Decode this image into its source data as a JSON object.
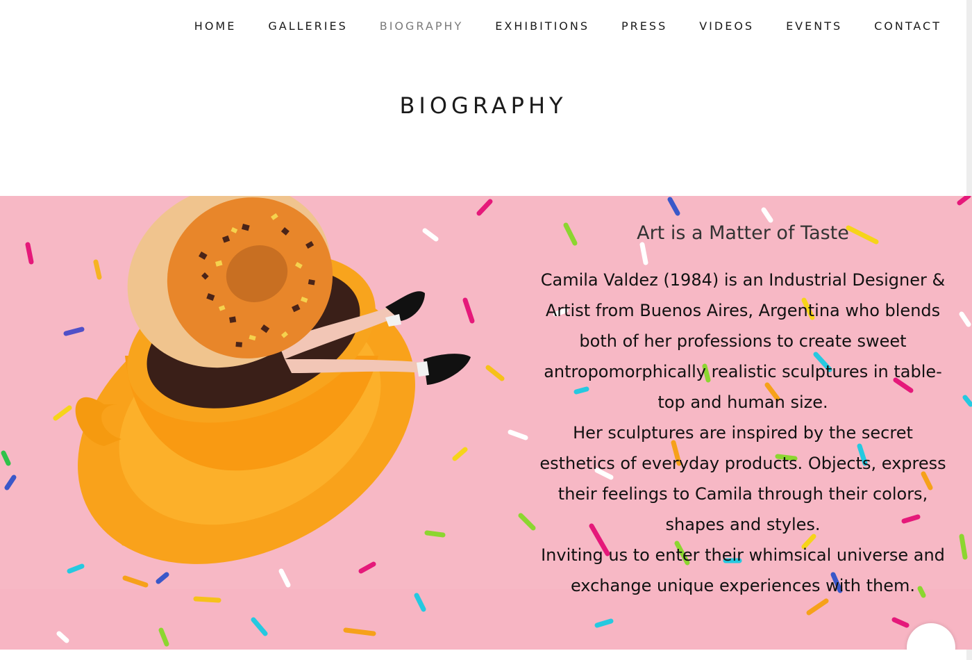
{
  "nav": {
    "items": [
      {
        "label": "HOME",
        "active": false
      },
      {
        "label": "GALLERIES",
        "active": false
      },
      {
        "label": "BIOGRAPHY",
        "active": true
      },
      {
        "label": "EXHIBITIONS",
        "active": false
      },
      {
        "label": "PRESS",
        "active": false
      },
      {
        "label": "VIDEOS",
        "active": false
      },
      {
        "label": "EVENTS",
        "active": false
      },
      {
        "label": "CONTACT",
        "active": false
      }
    ]
  },
  "page": {
    "title": "BIOGRAPHY"
  },
  "hero": {
    "subtitle": "Art is a Matter of Taste",
    "paragraphs": [
      "Camila Valdez (1984) is an Industrial Designer & Artist from Buenos Aires, Argentina who blends both of her professions to create sweet antropomorphically realistic sculptures in table-top and human size.",
      "Her sculptures are inspired by the secret esthetics of everyday products. Objects, express their feelings to Camila through their colors, shapes and styles.",
      "Inviting us to enter their whimsical universe and exchange unique experiences with them."
    ],
    "icons": {
      "artwork": "donut-in-teacup-sculpture",
      "decoration": "sprinkles"
    }
  },
  "colors": {
    "background_pink": "#f7b8c5",
    "cup_orange": "#f9a21b",
    "nav_active": "#7a7a7a",
    "text": "#111111"
  }
}
